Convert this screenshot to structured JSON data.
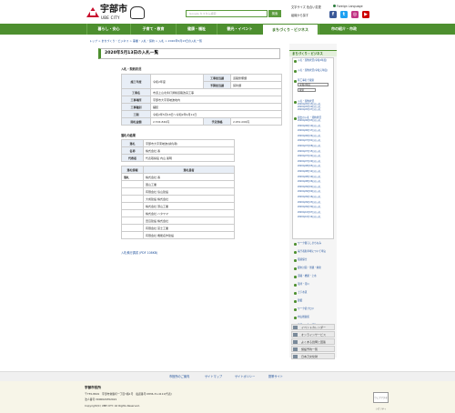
{
  "header": {
    "logo_text": "宇部市",
    "logo_sub": "UBE CITY",
    "search_placeholder": "Google カスタム検索",
    "search_button": "検索",
    "links": "文字サイズ 色合い変更",
    "foreign_language": "Foreign Language",
    "mobile_link": "組織から探す",
    "sns": [
      {
        "name": "facebook-icon",
        "glyph": "f",
        "color": "#3b5998"
      },
      {
        "name": "twitter-icon",
        "glyph": "t",
        "color": "#1da1f2"
      },
      {
        "name": "instagram-icon",
        "glyph": "◎",
        "color": "#c13584"
      },
      {
        "name": "youtube-icon",
        "glyph": "▶",
        "color": "#cc0000"
      }
    ]
  },
  "nav": {
    "items": [
      {
        "label": "暮らし・安心",
        "active": false
      },
      {
        "label": "子育て・教育",
        "active": false
      },
      {
        "label": "健康・福祉",
        "active": false
      },
      {
        "label": "観光・イベント",
        "active": false
      },
      {
        "label": "まちづくり・ビジネス",
        "active": true
      },
      {
        "label": "市の紹介・市政",
        "active": false
      }
    ]
  },
  "breadcrumb": "トップ > まちづくり・ビジネス > 事業・入札・契約 > 入札 > 2020年5月13日の入札一覧",
  "main": {
    "title": "2020年5月13日の入札一覧",
    "section1": "入札・契約状況",
    "table1": {
      "type_label": "施工年度",
      "type_value": "令和2年度",
      "method_label": "工事担当課",
      "method_value": "道路整備課",
      "jv_label": "予算担当課",
      "jv_value": "契約課",
      "name_label": "工事名",
      "name_value": "市道上山北条打通線道路改良工事",
      "place_label": "工事場所",
      "place_value": "宇部市大字東岐波地内",
      "kind_label": "工事種別",
      "kind_value": "舗装",
      "period_label": "工期",
      "period_value": "令和2年5月18日～令和2年9月11日",
      "price_label": "開札金額",
      "price_value": "2,534,840円",
      "plan_label": "予定価格",
      "plan_value": "2,651,000円"
    },
    "section2": "落札の結果",
    "table2": {
      "winner_label": "落札",
      "winner_value": "宇部市大字東岐波(請負者)",
      "company_label": "名称",
      "company_value": "株式会社 番",
      "rep_label": "代表者",
      "rep_value": "代表取締役 内山 憲明"
    },
    "table3": {
      "col1": "落札情報",
      "col2": "落札業者",
      "mark": "落札",
      "bidders": [
        "株式会社 番",
        "国山工業",
        "有限会社 協山建設",
        "大成建設 株式会社",
        "株式会社 頭山工業",
        "株式会社 ハタヤマ",
        "田辺建設 株式会社",
        "有限会社 富士工業",
        "有限会社 機能名作建設"
      ]
    },
    "pdf_link": "入札執行調書 (PDF 108KB)"
  },
  "sidebar": {
    "heading": "まちづくり・ビジネス",
    "links": [
      "入札・契約状況(令和2年度)",
      "入札・契約状況(令和元年度)",
      "等工事名で検索",
      "入札・契約状況",
      "過去の入札・契約状況"
    ],
    "input_label": "令和2年度",
    "input_value": "検索",
    "mini_prefix": "2020年",
    "mini_links": [
      "2020年05月13日の入札",
      "2020年05月20日の入札",
      "2020年05月27日の入札",
      "2020年06月03日の入札",
      "2020年06月10日の入札",
      "2020年06月17日の入札",
      "2020年06月24日の入札",
      "2020年07月01日の入札",
      "2020年07月08日の入札",
      "2020年07月15日の入札",
      "2020年07月22日の入札",
      "2020年07月29日の入札",
      "2020年08月05日の入札",
      "2020年08月12日の入札",
      "2020年08月19日の入札",
      "2020年08月26日の入札",
      "2020年09月02日の入札",
      "2020年09月09日の入札",
      "2020年09月16日の入札",
      "2020年09月23日の入札",
      "2020年09月30日の入札",
      "2020年10月07日の入札",
      "2020年10月14日の入札"
    ],
    "lower_links": [
      "ワーク暮らしまちなみ",
      "来庁者駐車場について申込",
      "環境保全",
      "都市計画・景観・緑化",
      "道路・橋梁・上水",
      "港湾・河川",
      "上下水道",
      "建築",
      "ワーク宿プロジ",
      "内山推進館",
      "事業・入札・契約"
    ],
    "banners": [
      "イベントカレンダー",
      "オンラインサービス",
      "よくある質問と回答",
      "施設予約一覧",
      "日本刀文化財"
    ]
  },
  "footer": {
    "links": [
      "市役所のご案内",
      "サイトマップ",
      "サイトポリシー",
      "携帯サイト"
    ],
    "name": "宇部市役所",
    "address": "〒755-8601　宇部市常盤町一丁目7番1号　電話番号:0836-31-4111(代表)",
    "corp_no": "法人番号:3000020352021",
    "copyright": "Copyright(C) UBE CITY. All Rights Reserved.",
    "badge": "ウェブアクセシビリティ"
  }
}
